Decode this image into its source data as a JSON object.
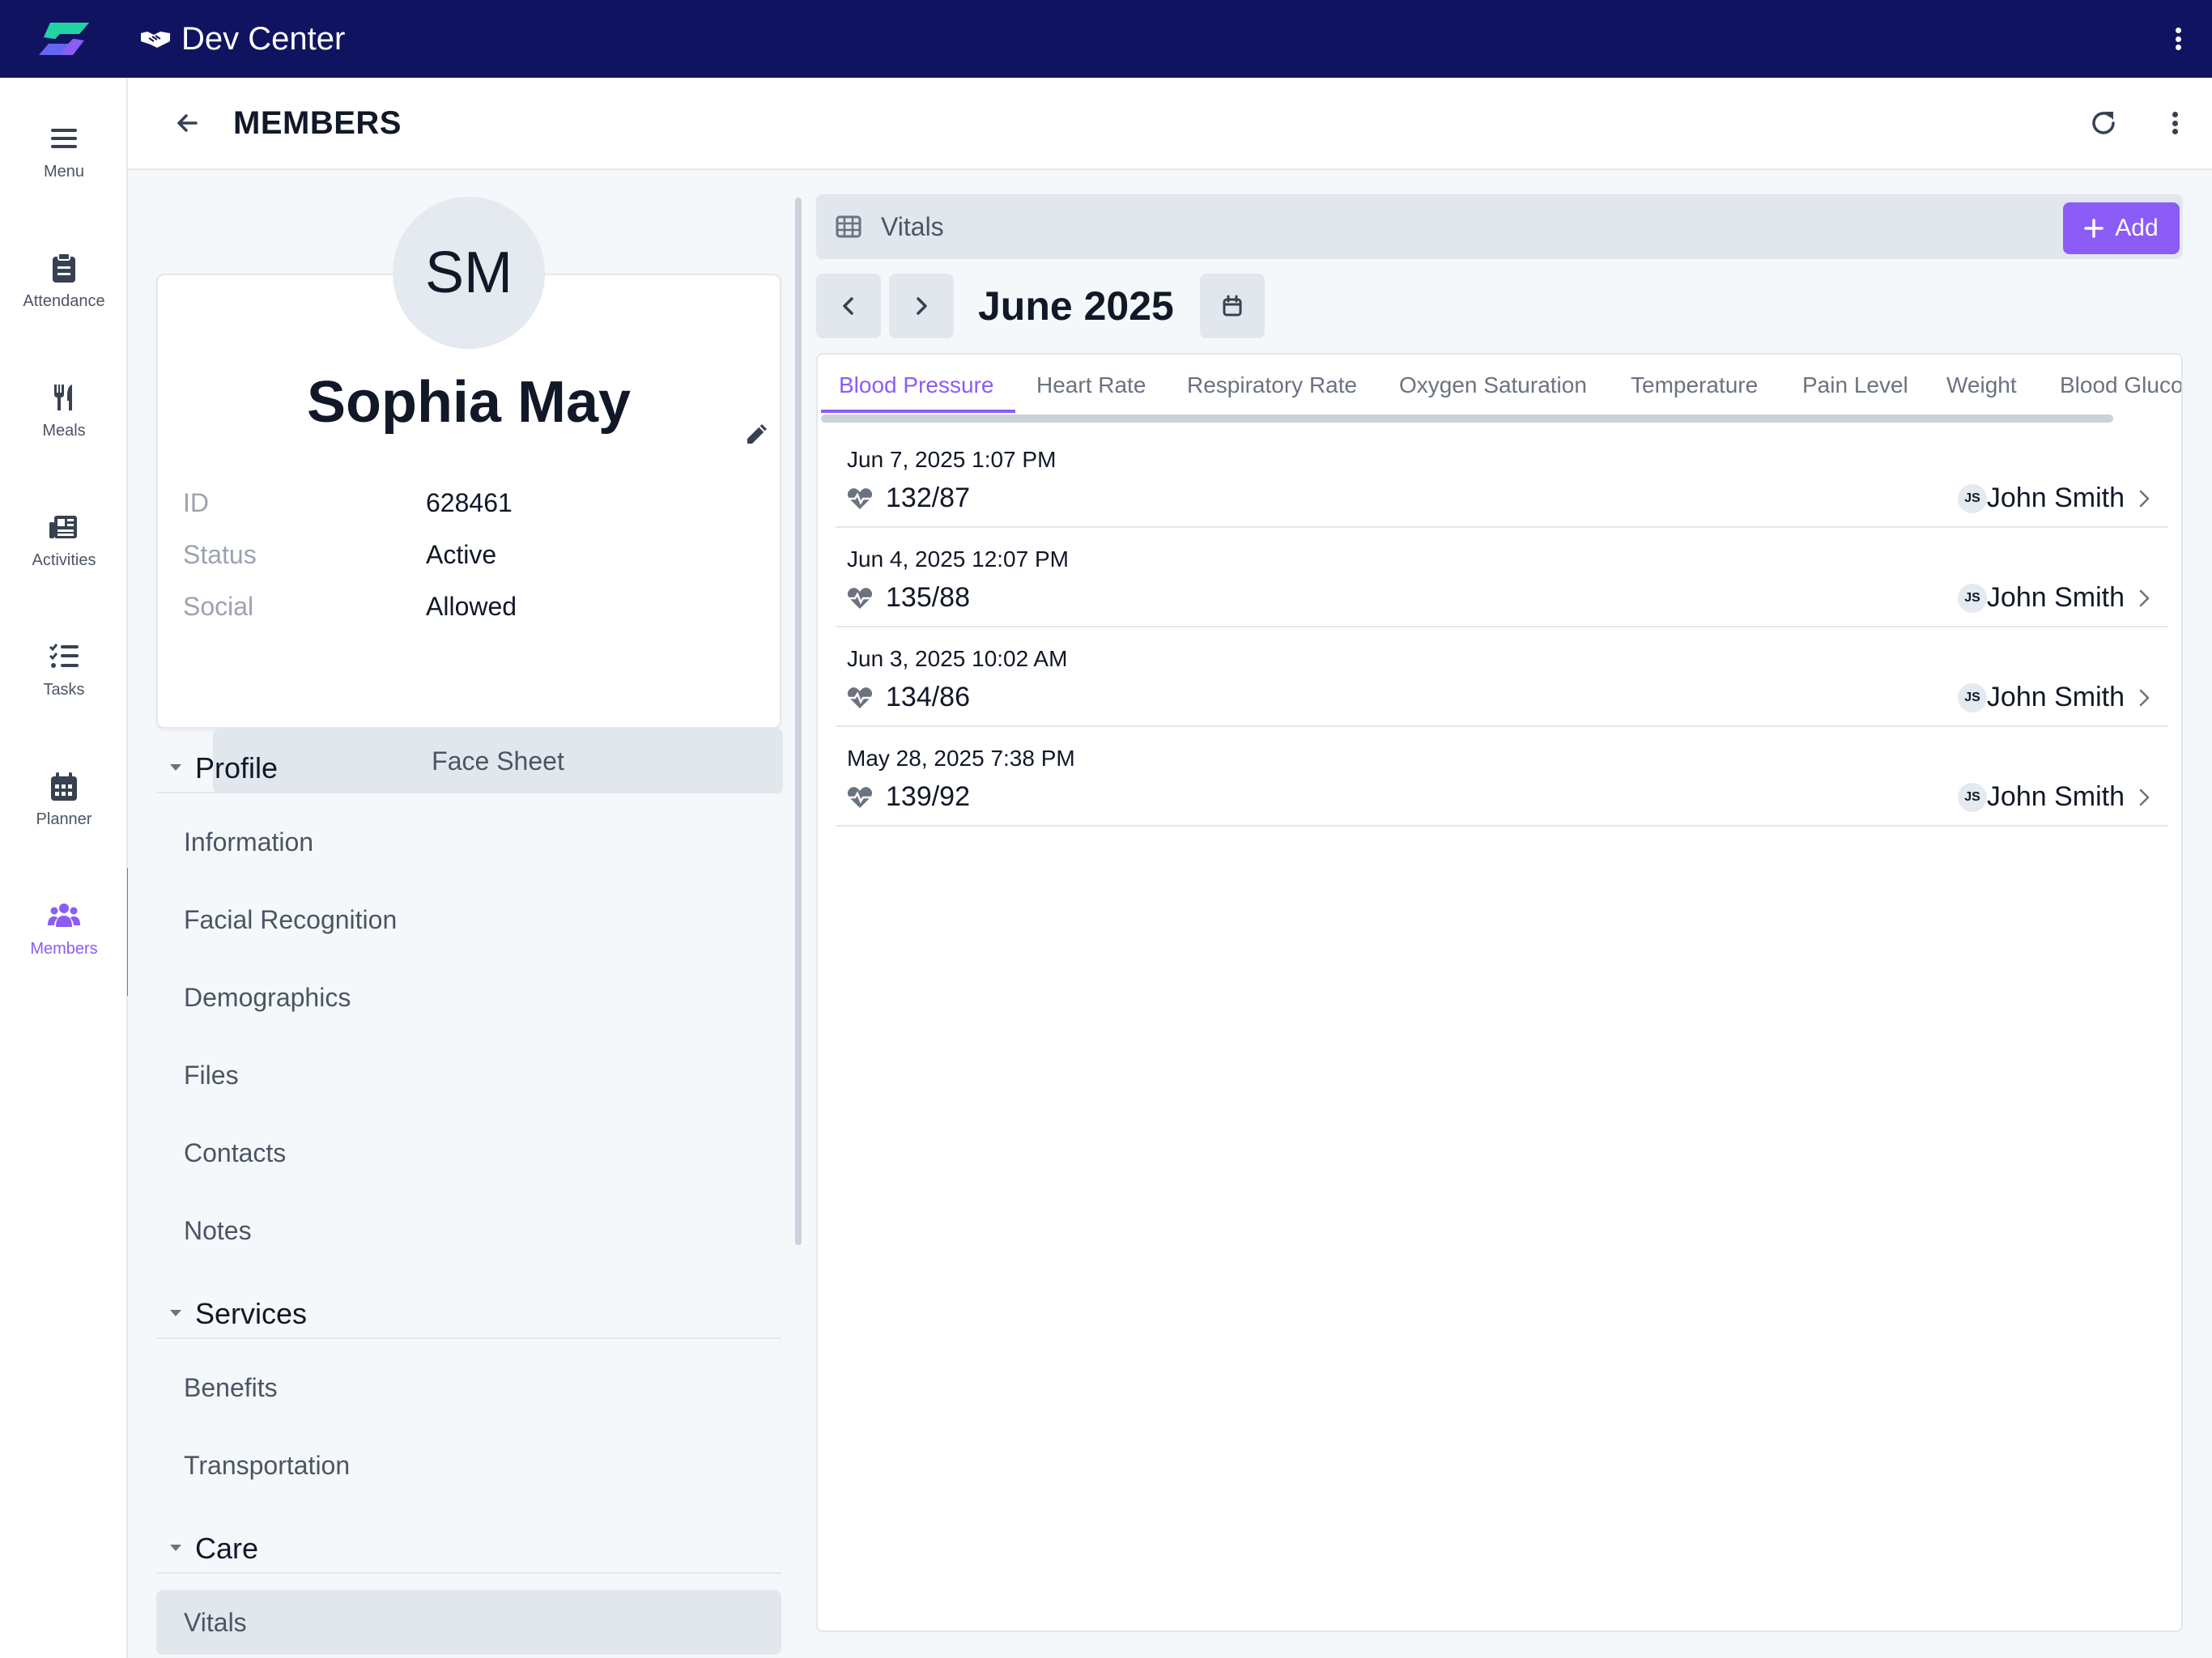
{
  "app": {
    "title": "Dev Center",
    "logo_icon": "brand-logo",
    "brand_colors": {
      "header_bg": "#101460",
      "accent": "#8b5cf6"
    }
  },
  "rail": {
    "items": [
      {
        "label": "Menu",
        "icon": "hamburger-icon"
      },
      {
        "label": "Attendance",
        "icon": "clipboard-icon"
      },
      {
        "label": "Meals",
        "icon": "utensils-icon"
      },
      {
        "label": "Activities",
        "icon": "newspaper-icon"
      },
      {
        "label": "Tasks",
        "icon": "task-list-icon"
      },
      {
        "label": "Planner",
        "icon": "calendar-icon"
      },
      {
        "label": "Members",
        "icon": "users-icon",
        "active": true
      }
    ]
  },
  "header": {
    "title": "MEMBERS"
  },
  "member": {
    "initials": "SM",
    "name": "Sophia May",
    "fields": [
      {
        "key": "ID",
        "value": "628461"
      },
      {
        "key": "Status",
        "value": "Active"
      },
      {
        "key": "Social",
        "value": "Allowed"
      }
    ],
    "face_sheet_label": "Face Sheet"
  },
  "sections": {
    "profile": {
      "label": "Profile",
      "items": [
        "Information",
        "Facial Recognition",
        "Demographics",
        "Files",
        "Contacts",
        "Notes"
      ]
    },
    "services": {
      "label": "Services",
      "items": [
        "Benefits",
        "Transportation"
      ]
    },
    "care": {
      "label": "Care",
      "items": [
        "Vitals"
      ],
      "selected": "Vitals"
    }
  },
  "vitals": {
    "title": "Vitals",
    "add_label": "Add",
    "month": "June 2025",
    "tabs": [
      "Blood Pressure",
      "Heart Rate",
      "Respiratory Rate",
      "Oxygen Saturation",
      "Temperature",
      "Pain Level",
      "Weight",
      "Blood Gluco"
    ],
    "active_tab": "Blood Pressure",
    "records": [
      {
        "date": "Jun 7, 2025 1:07 PM",
        "value": "132/87",
        "initials": "JS",
        "recorder": "John Smith"
      },
      {
        "date": "Jun 4, 2025 12:07 PM",
        "value": "135/88",
        "initials": "JS",
        "recorder": "John Smith"
      },
      {
        "date": "Jun 3, 2025 10:02 AM",
        "value": "134/86",
        "initials": "JS",
        "recorder": "John Smith"
      },
      {
        "date": "May 28, 2025 7:38 PM",
        "value": "139/92",
        "initials": "JS",
        "recorder": "John Smith"
      }
    ]
  }
}
